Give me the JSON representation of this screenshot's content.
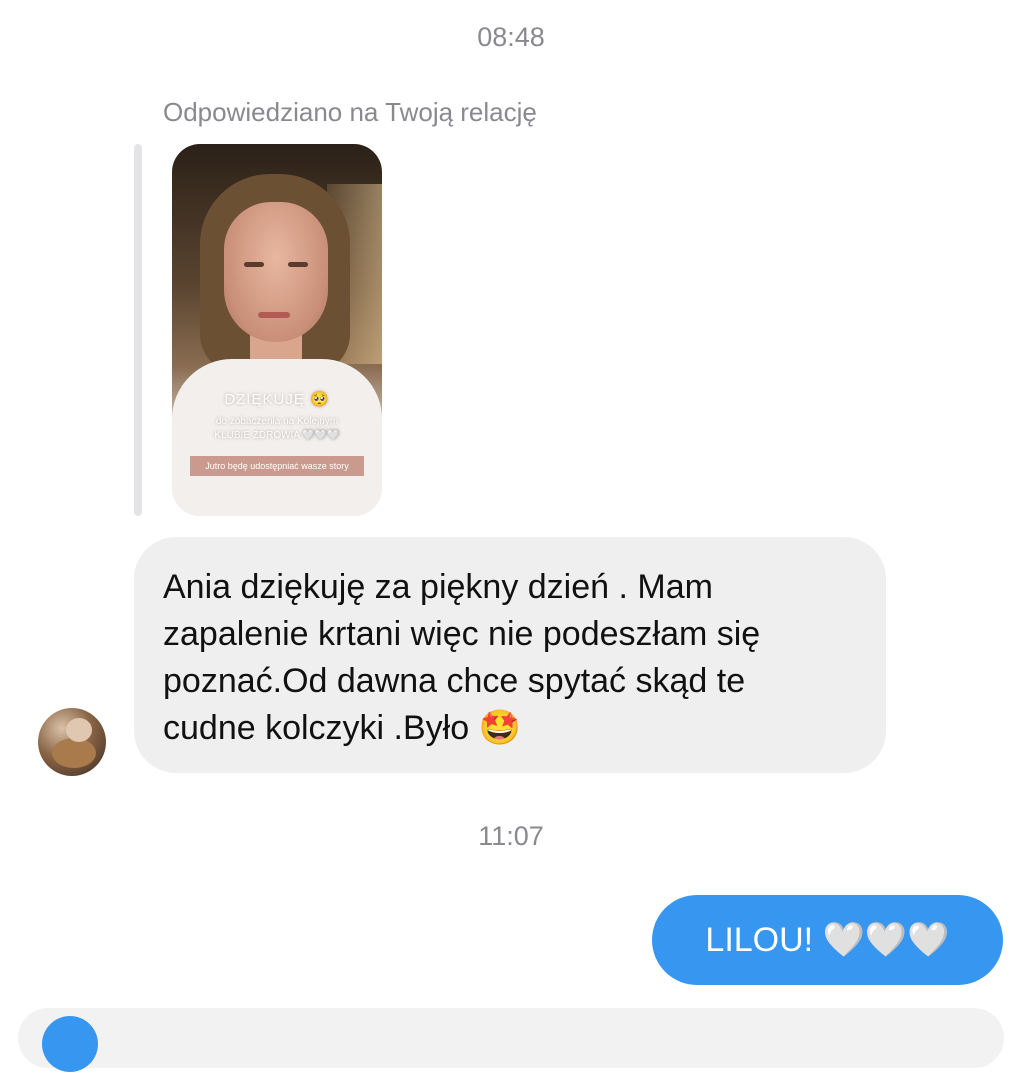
{
  "timestamps": {
    "first": "08:48",
    "second": "11:07"
  },
  "reply": {
    "label": "Odpowiedziano na Twoją relację"
  },
  "story": {
    "title": "DZIĘKUJĘ 🥺",
    "line1": "do zobaczenia na Kolejnym",
    "line2": "KLUBIE ZDROWIA 🤍🤍🤍",
    "bar_text": "Jutro będę udostępniać wasze story"
  },
  "incoming_message": {
    "text": "Ania dziękuję za piękny dzień . Mam\nzapalenie krtani więc nie podeszłam się\npoznać.Od dawna chce spytać skąd te\ncudne kolczyki .Było 🤩"
  },
  "outgoing_message": {
    "text": "LILOU! 🤍🤍🤍"
  },
  "colors": {
    "outgoing_bubble": "#3797f0",
    "incoming_bubble": "#efefef",
    "timestamp": "#8a8a8e"
  }
}
